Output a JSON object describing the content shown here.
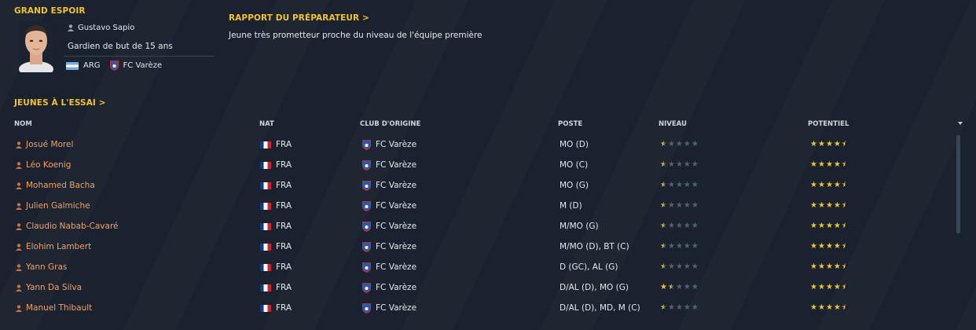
{
  "hot_prospect": {
    "section_title": "GRAND ESPOIR",
    "name": "Gustavo Sapio",
    "description": "Gardien de but de 15 ans",
    "nationality": "ARG",
    "club": "FC Varèze"
  },
  "coach_report": {
    "section_title": "RAPPORT DU PRÉPARATEUR >",
    "text": "Jeune très prometteur proche du niveau de l'équipe première"
  },
  "trials": {
    "section_title": "JEUNES À L'ESSAI >",
    "columns": {
      "name": "NOM",
      "nat": "NAT",
      "club": "CLUB D'ORIGINE",
      "position": "POSTE",
      "level": "NIVEAU",
      "potential": "POTENTIEL"
    },
    "rows": [
      {
        "name": "Josué Morel",
        "nat": "FRA",
        "club": "FC Varèze",
        "position": "MO (D)",
        "level_stars": 0.5,
        "potential_stars": 4.5
      },
      {
        "name": "Léo Koenig",
        "nat": "FRA",
        "club": "FC Varèze",
        "position": "MO (C)",
        "level_stars": 0.5,
        "potential_stars": 4.5
      },
      {
        "name": "Mohamed Bacha",
        "nat": "FRA",
        "club": "FC Varèze",
        "position": "MO (G)",
        "level_stars": 0.5,
        "potential_stars": 4.5
      },
      {
        "name": "Julien Galmiche",
        "nat": "FRA",
        "club": "FC Varèze",
        "position": "M (D)",
        "level_stars": 0.5,
        "potential_stars": 4.5
      },
      {
        "name": "Claudio Nabab-Cavaré",
        "nat": "FRA",
        "club": "FC Varèze",
        "position": "M/MO (G)",
        "level_stars": 0.5,
        "potential_stars": 4.5
      },
      {
        "name": "Elohim Lambert",
        "nat": "FRA",
        "club": "FC Varèze",
        "position": "M/MO (D), BT (C)",
        "level_stars": 0.5,
        "potential_stars": 4.5
      },
      {
        "name": "Yann Gras",
        "nat": "FRA",
        "club": "FC Varèze",
        "position": "D (GC), AL (G)",
        "level_stars": 0.5,
        "potential_stars": 4.5
      },
      {
        "name": "Yann Da Silva",
        "nat": "FRA",
        "club": "FC Varèze",
        "position": "D/AL (D), MO (G)",
        "level_stars": 1.5,
        "potential_stars": 4.5
      },
      {
        "name": "Manuel Thibault",
        "nat": "FRA",
        "club": "FC Varèze",
        "position": "D/AL (D), MD, M (C)",
        "level_stars": 0.5,
        "potential_stars": 4.5
      }
    ]
  },
  "colors": {
    "background": "#1b2330",
    "accent_yellow": "#f2c230",
    "player_name": "#f0a06a"
  },
  "icons": [
    "person-icon",
    "argentina-flag-icon",
    "france-flag-icon",
    "club-crest-icon",
    "star-icon",
    "sort-arrow-icon"
  ]
}
